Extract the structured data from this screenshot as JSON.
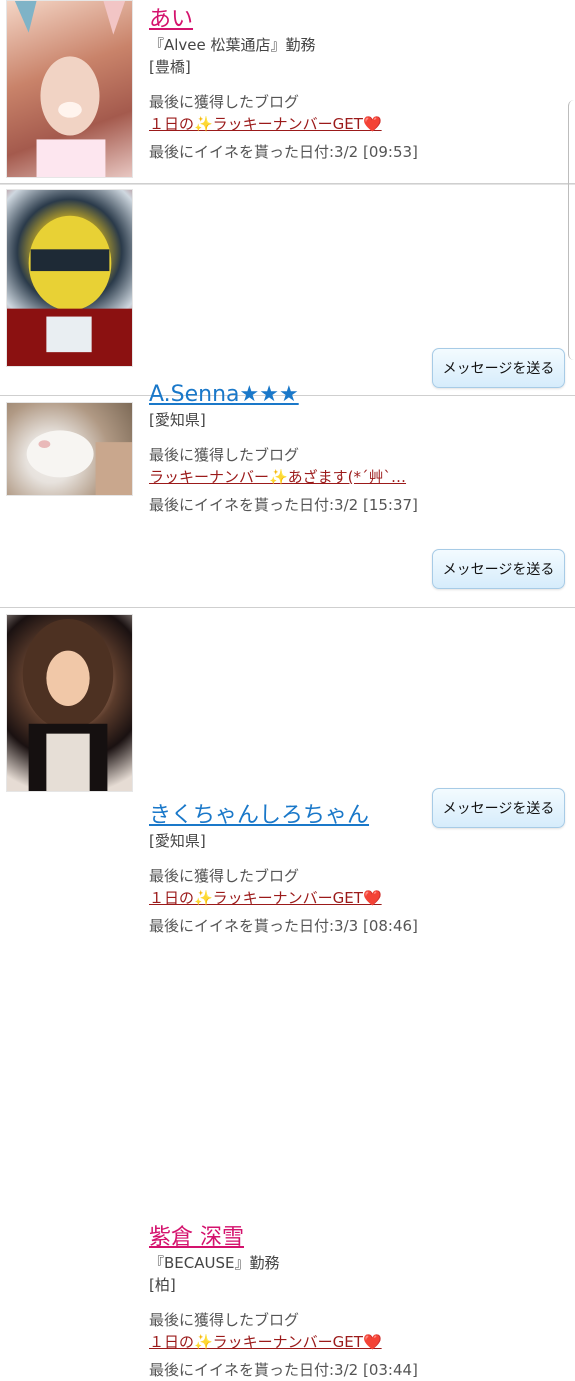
{
  "profiles": [
    {
      "name": "あい",
      "name_color": "pink",
      "workplace": "『Alvee 松葉通店』勤務",
      "area": "[豊橋]",
      "last_blog_label": "最後に獲得したブログ",
      "last_blog_title": "１日の✨ラッキーナンバーGET❤️",
      "last_like_date": "最後にイイネを貰った日付:3/2 [09:53]",
      "message_button": ""
    },
    {
      "name": "A.Senna★★★",
      "name_color": "blue",
      "area": "[愛知県]",
      "last_blog_label": "最後に獲得したブログ",
      "last_blog_title": "ラッキーナンバー✨あざます(*´艸`…",
      "last_like_date": "最後にイイネを貰った日付:3/2 [15:37]",
      "message_button": "メッセージを送る"
    },
    {
      "name": "きくちゃんしろちゃん",
      "name_color": "blue",
      "area": "[愛知県]",
      "last_blog_label": "最後に獲得したブログ",
      "last_blog_title": "１日の✨ラッキーナンバーGET❤️",
      "last_like_date": "最後にイイネを貰った日付:3/3 [08:46]",
      "message_button": "メッセージを送る"
    },
    {
      "name": "紫倉 深雪",
      "name_color": "pink",
      "workplace": "『BECAUSE』勤務",
      "area": "[柏]",
      "last_blog_label": "最後に獲得したブログ",
      "last_blog_title": "１日の✨ラッキーナンバーGET❤️",
      "last_like_date": "最後にイイネを貰った日付:3/2 [03:44]",
      "message_button": "メッセージを送る"
    }
  ],
  "icons": {
    "avatar": "profile-photo"
  }
}
